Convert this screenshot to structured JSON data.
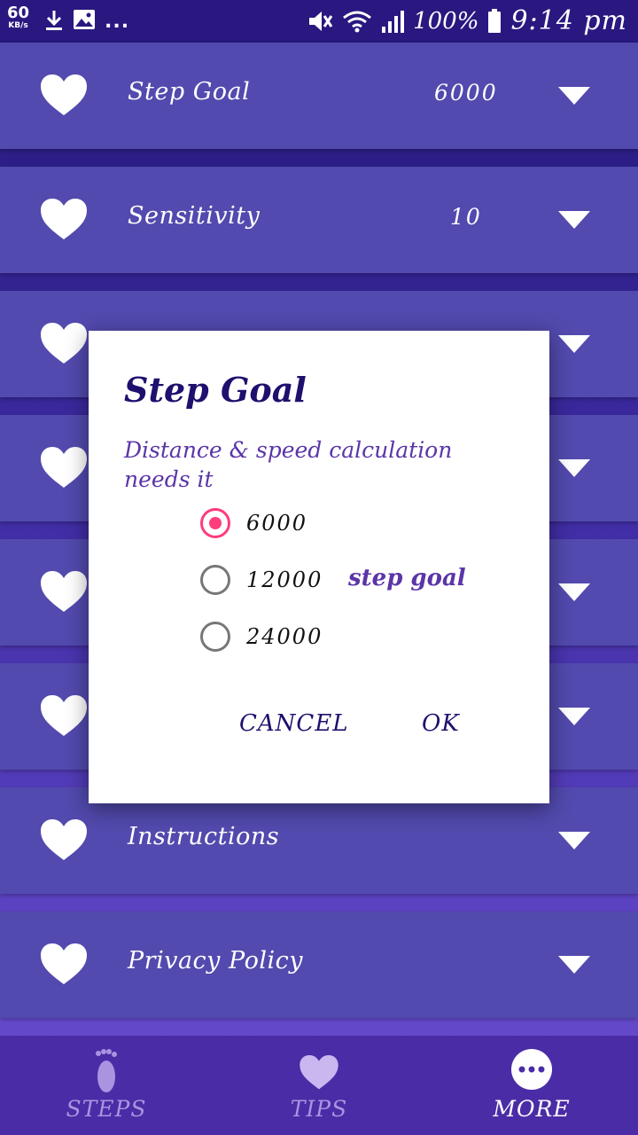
{
  "status_bar": {
    "speed_value": "60",
    "speed_unit": "KB/s",
    "dots": "...",
    "battery": "100%",
    "time": "9:14 pm"
  },
  "settings": [
    {
      "label": "Step Goal",
      "value": "6000"
    },
    {
      "label": "Sensitivity",
      "value": "10"
    },
    {
      "label": "",
      "value": ""
    },
    {
      "label": "",
      "value": ""
    },
    {
      "label": "",
      "value": ""
    },
    {
      "label": "",
      "value": ""
    },
    {
      "label": "Instructions",
      "value": ""
    },
    {
      "label": "Privacy Policy",
      "value": ""
    }
  ],
  "dialog": {
    "title": "Step Goal",
    "message": "Distance & speed calculation needs it",
    "options": [
      {
        "label": "6000",
        "selected": true
      },
      {
        "label": "12000",
        "selected": false
      },
      {
        "label": "24000",
        "selected": false
      }
    ],
    "hint": "step goal",
    "cancel_label": "CANCEL",
    "ok_label": "OK"
  },
  "bottom_nav": [
    {
      "label": "STEPS",
      "icon": "footprint-icon",
      "active": false
    },
    {
      "label": "TIPS",
      "icon": "heart-icon",
      "active": false
    },
    {
      "label": "MORE",
      "icon": "more-dots-icon",
      "active": true
    }
  ],
  "colors": {
    "row_bg": "#524aae",
    "dialog_title": "#1f0f6e",
    "accent": "#ff3c7c",
    "hint": "#5b35a8"
  }
}
